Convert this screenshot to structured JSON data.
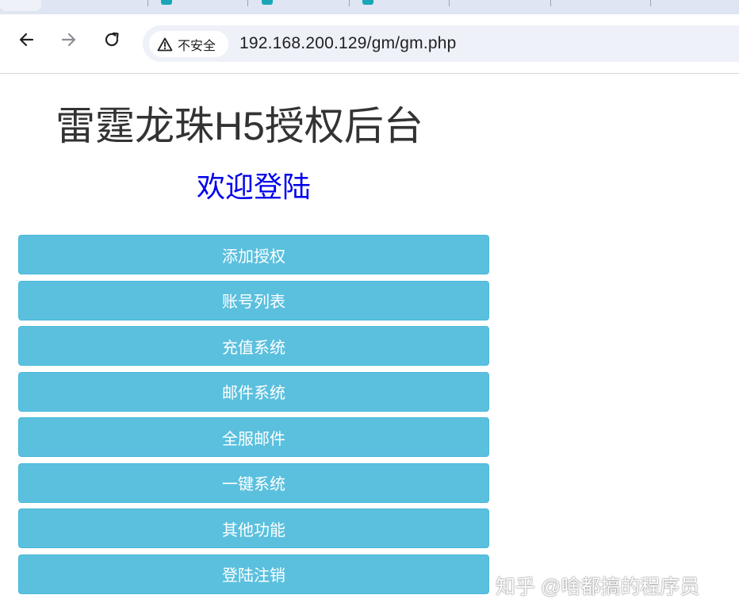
{
  "browser": {
    "security_label": "不安全",
    "url": "192.168.200.129/gm/gm.php",
    "icons": {
      "back": "back-arrow-icon",
      "forward": "forward-arrow-icon",
      "reload": "reload-icon",
      "warning": "warning-triangle-icon"
    }
  },
  "page": {
    "title": "雷霆龙珠H5授权后台",
    "welcome": "欢迎登陆",
    "menu": [
      {
        "label": "添加授权"
      },
      {
        "label": "账号列表"
      },
      {
        "label": "充值系统"
      },
      {
        "label": "邮件系统"
      },
      {
        "label": "全服邮件"
      },
      {
        "label": "一键系统"
      },
      {
        "label": "其他功能"
      },
      {
        "label": "登陆注销"
      }
    ]
  },
  "watermark": "知乎 @啥都搞的程序员",
  "colors": {
    "button_bg": "#5bc0de",
    "button_border": "#46b8da",
    "welcome_text": "#0000ee",
    "title_text": "#333333"
  }
}
